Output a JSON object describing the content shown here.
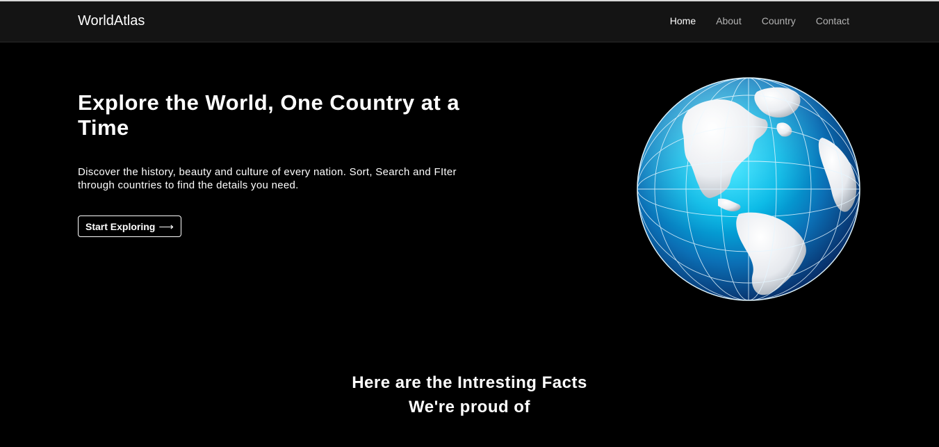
{
  "header": {
    "logo": "WorldAtlas",
    "nav": [
      {
        "label": "Home",
        "active": true
      },
      {
        "label": "About",
        "active": false
      },
      {
        "label": "Country",
        "active": false
      },
      {
        "label": "Contact",
        "active": false
      }
    ]
  },
  "hero": {
    "title": "Explore the World, One Country at a Time",
    "description": "Discover the history, beauty and culture of every nation. Sort, Search and FIter through countries to find the details you need.",
    "cta_label": "Start Exploring",
    "cta_icon": "arrow-right-icon",
    "image": "globe-americas"
  },
  "facts": {
    "title_line1": "Here are the Intresting Facts",
    "title_line2": "We're proud of"
  },
  "colors": {
    "background": "#000000",
    "header_bg": "#141414",
    "nav_inactive": "#b3b3b3",
    "globe_ocean": "#00b8e6",
    "globe_deep": "#08306b"
  }
}
